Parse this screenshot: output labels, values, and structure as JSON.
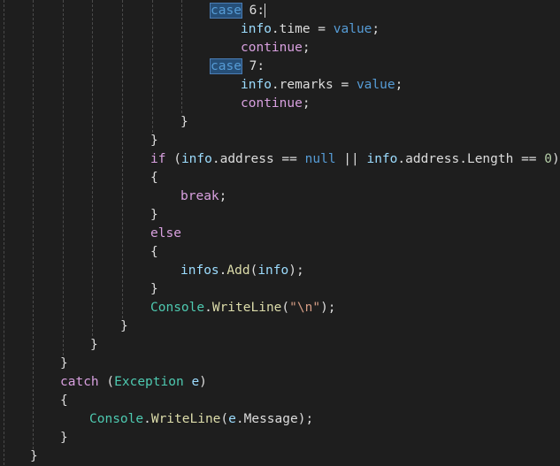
{
  "editor": {
    "lines": [
      {
        "tokens": [
          {
            "t": "case",
            "c": "kw hl"
          },
          {
            "t": " 6:",
            "c": "punct"
          }
        ],
        "caret": true
      },
      {
        "tokens": [
          {
            "t": "info",
            "c": "local"
          },
          {
            "t": ".time = ",
            "c": "punct"
          },
          {
            "t": "value",
            "c": "kw"
          },
          {
            "t": ";",
            "c": "punct"
          }
        ]
      },
      {
        "tokens": [
          {
            "t": "continue",
            "c": "kw2"
          },
          {
            "t": ";",
            "c": "punct"
          }
        ]
      },
      {
        "tokens": [
          {
            "t": "case",
            "c": "kw hl"
          },
          {
            "t": " 7:",
            "c": "punct"
          }
        ]
      },
      {
        "tokens": [
          {
            "t": "info",
            "c": "local"
          },
          {
            "t": ".remarks = ",
            "c": "punct"
          },
          {
            "t": "value",
            "c": "kw"
          },
          {
            "t": ";",
            "c": "punct"
          }
        ]
      },
      {
        "tokens": [
          {
            "t": "continue",
            "c": "kw2"
          },
          {
            "t": ";",
            "c": "punct"
          }
        ]
      },
      {
        "tokens": [
          {
            "t": "}",
            "c": "punct"
          }
        ]
      },
      {
        "tokens": [
          {
            "t": "}",
            "c": "punct"
          }
        ]
      },
      {
        "tokens": [
          {
            "t": "if",
            "c": "kw2"
          },
          {
            "t": " (",
            "c": "punct"
          },
          {
            "t": "info",
            "c": "local"
          },
          {
            "t": ".address == ",
            "c": "punct"
          },
          {
            "t": "null",
            "c": "kw"
          },
          {
            "t": " || ",
            "c": "punct"
          },
          {
            "t": "info",
            "c": "local"
          },
          {
            "t": ".address.Length == ",
            "c": "punct"
          },
          {
            "t": "0",
            "c": "num"
          },
          {
            "t": ")",
            "c": "punct"
          }
        ]
      },
      {
        "tokens": [
          {
            "t": "{",
            "c": "punct"
          }
        ]
      },
      {
        "tokens": [
          {
            "t": "break",
            "c": "kw2"
          },
          {
            "t": ";",
            "c": "punct"
          }
        ]
      },
      {
        "tokens": [
          {
            "t": "}",
            "c": "punct"
          }
        ]
      },
      {
        "tokens": [
          {
            "t": "else",
            "c": "kw2"
          }
        ]
      },
      {
        "tokens": [
          {
            "t": "{",
            "c": "punct"
          }
        ]
      },
      {
        "tokens": [
          {
            "t": "infos",
            "c": "local"
          },
          {
            "t": ".",
            "c": "punct"
          },
          {
            "t": "Add",
            "c": "method"
          },
          {
            "t": "(",
            "c": "punct"
          },
          {
            "t": "info",
            "c": "local"
          },
          {
            "t": ");",
            "c": "punct"
          }
        ]
      },
      {
        "tokens": [
          {
            "t": "}",
            "c": "punct"
          }
        ]
      },
      {
        "tokens": [
          {
            "t": "Console",
            "c": "type"
          },
          {
            "t": ".",
            "c": "punct"
          },
          {
            "t": "WriteLine",
            "c": "method"
          },
          {
            "t": "(",
            "c": "punct"
          },
          {
            "t": "\"\\n\"",
            "c": "str"
          },
          {
            "t": ");",
            "c": "punct"
          }
        ]
      },
      {
        "tokens": [
          {
            "t": "}",
            "c": "punct"
          }
        ]
      },
      {
        "tokens": [
          {
            "t": "}",
            "c": "punct"
          }
        ]
      },
      {
        "tokens": [
          {
            "t": "}",
            "c": "punct"
          }
        ]
      },
      {
        "tokens": [
          {
            "t": "catch",
            "c": "kw2"
          },
          {
            "t": " (",
            "c": "punct"
          },
          {
            "t": "Exception",
            "c": "type"
          },
          {
            "t": " ",
            "c": "punct"
          },
          {
            "t": "e",
            "c": "param"
          },
          {
            "t": ")",
            "c": "punct"
          }
        ]
      },
      {
        "tokens": [
          {
            "t": "{",
            "c": "punct"
          }
        ]
      },
      {
        "tokens": [
          {
            "t": "Console",
            "c": "type"
          },
          {
            "t": ".",
            "c": "punct"
          },
          {
            "t": "WriteLine",
            "c": "method"
          },
          {
            "t": "(",
            "c": "punct"
          },
          {
            "t": "e",
            "c": "param"
          },
          {
            "t": ".Message);",
            "c": "punct"
          }
        ]
      },
      {
        "tokens": [
          {
            "t": "}",
            "c": "punct"
          }
        ]
      },
      {
        "tokens": [
          {
            "t": "}",
            "c": "punct"
          }
        ]
      }
    ]
  }
}
